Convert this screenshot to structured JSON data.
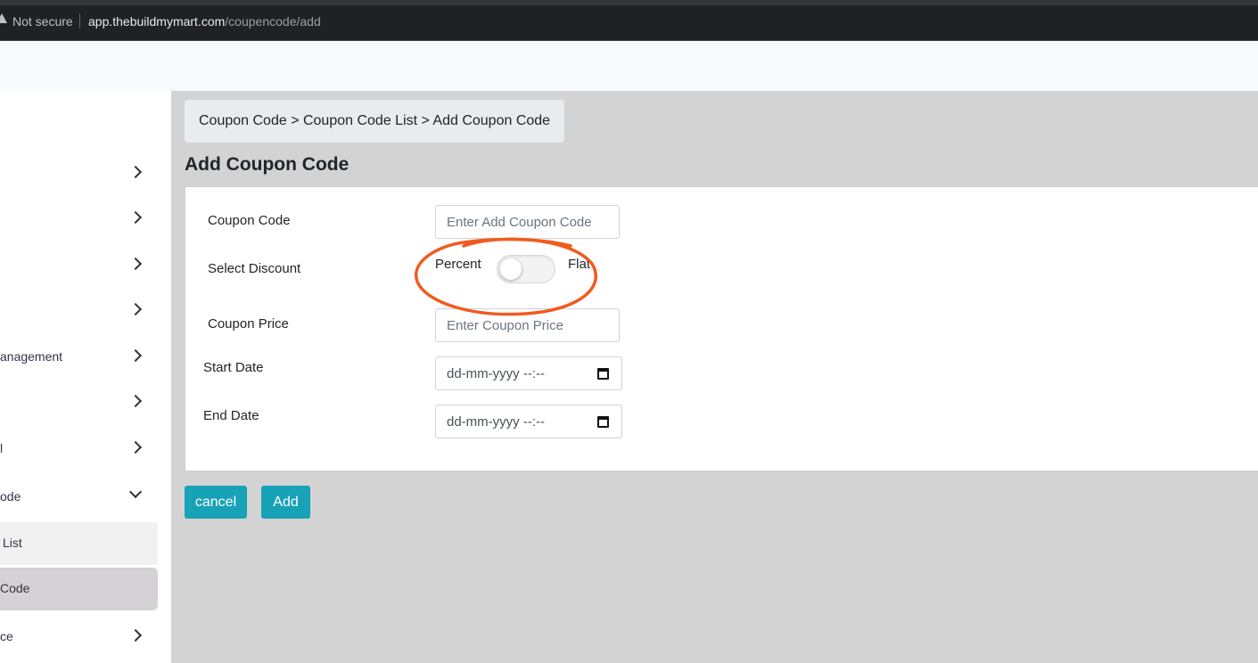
{
  "browser": {
    "security_label": "Not secure",
    "url_host": "app.thebuildmymart.com",
    "url_path": "/coupencode/add"
  },
  "sidebar": {
    "items": [
      {
        "label": ""
      },
      {
        "label": ""
      },
      {
        "label": ""
      },
      {
        "label": ""
      },
      {
        "label": "anagement"
      },
      {
        "label": ""
      },
      {
        "label": "l"
      },
      {
        "label": "ode"
      },
      {
        "label": ""
      }
    ],
    "sub_items": [
      {
        "label": "List"
      },
      {
        "label": "Code"
      }
    ],
    "last_item": {
      "label": "ce"
    }
  },
  "breadcrumb": "Coupon Code > Coupon Code List > Add Coupon Code",
  "page_title": "Add Coupon Code",
  "form": {
    "coupon_code": {
      "label": "Coupon Code",
      "placeholder": "Enter Add Coupon Code"
    },
    "discount": {
      "label": "Select Discount",
      "option_left": "Percent",
      "option_right": "Flat",
      "selected": "Percent"
    },
    "coupon_price": {
      "label": "Coupon Price",
      "placeholder": "Enter Coupon Price"
    },
    "start_date": {
      "label": "Start Date",
      "placeholder": "dd-mm-yyyy --:--"
    },
    "end_date": {
      "label": "End Date",
      "placeholder": "dd-mm-yyyy --:--"
    }
  },
  "buttons": {
    "cancel": "cancel",
    "add": "Add"
  },
  "colors": {
    "primary_button": "#17a2b8",
    "annotation": "#f15a1f"
  }
}
